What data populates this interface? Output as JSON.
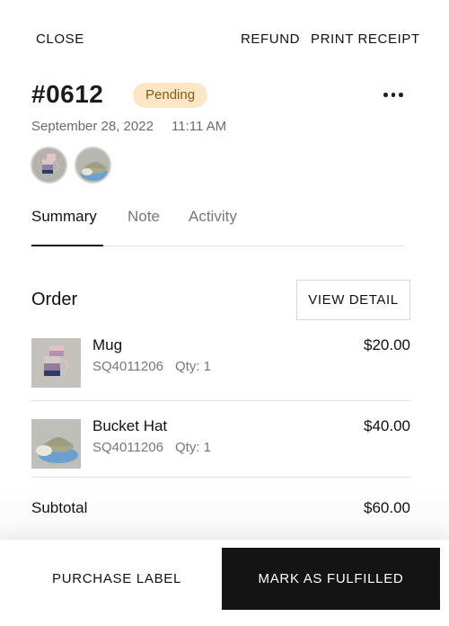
{
  "header": {
    "close_label": "CLOSE",
    "refund_label": "REFUND",
    "print_receipt_label": "PRINT RECEIPT"
  },
  "order": {
    "number": "#0612",
    "status": "Pending",
    "date": "September 28, 2022",
    "time": "11:11 AM",
    "more_icon": "more-horizontal-icon"
  },
  "tabs": [
    {
      "label": "Summary",
      "active": true
    },
    {
      "label": "Note",
      "active": false
    },
    {
      "label": "Activity",
      "active": false
    }
  ],
  "order_section": {
    "title": "Order",
    "view_detail_label": "VIEW DETAIL",
    "items": [
      {
        "name": "Mug",
        "sku": "SQ4011206",
        "qty": "Qty: 1",
        "price": "$20.00"
      },
      {
        "name": "Bucket Hat",
        "sku": "SQ4011206",
        "qty": "Qty: 1",
        "price": "$40.00"
      }
    ],
    "subtotal_label": "Subtotal",
    "subtotal_value": "$60.00"
  },
  "footer": {
    "purchase_label": "PURCHASE LABEL",
    "fulfill_label": "MARK AS FULFILLED"
  },
  "colors": {
    "badge_bg": "#fbe6c6",
    "badge_text": "#8a5a12",
    "primary_button": "#141414"
  }
}
